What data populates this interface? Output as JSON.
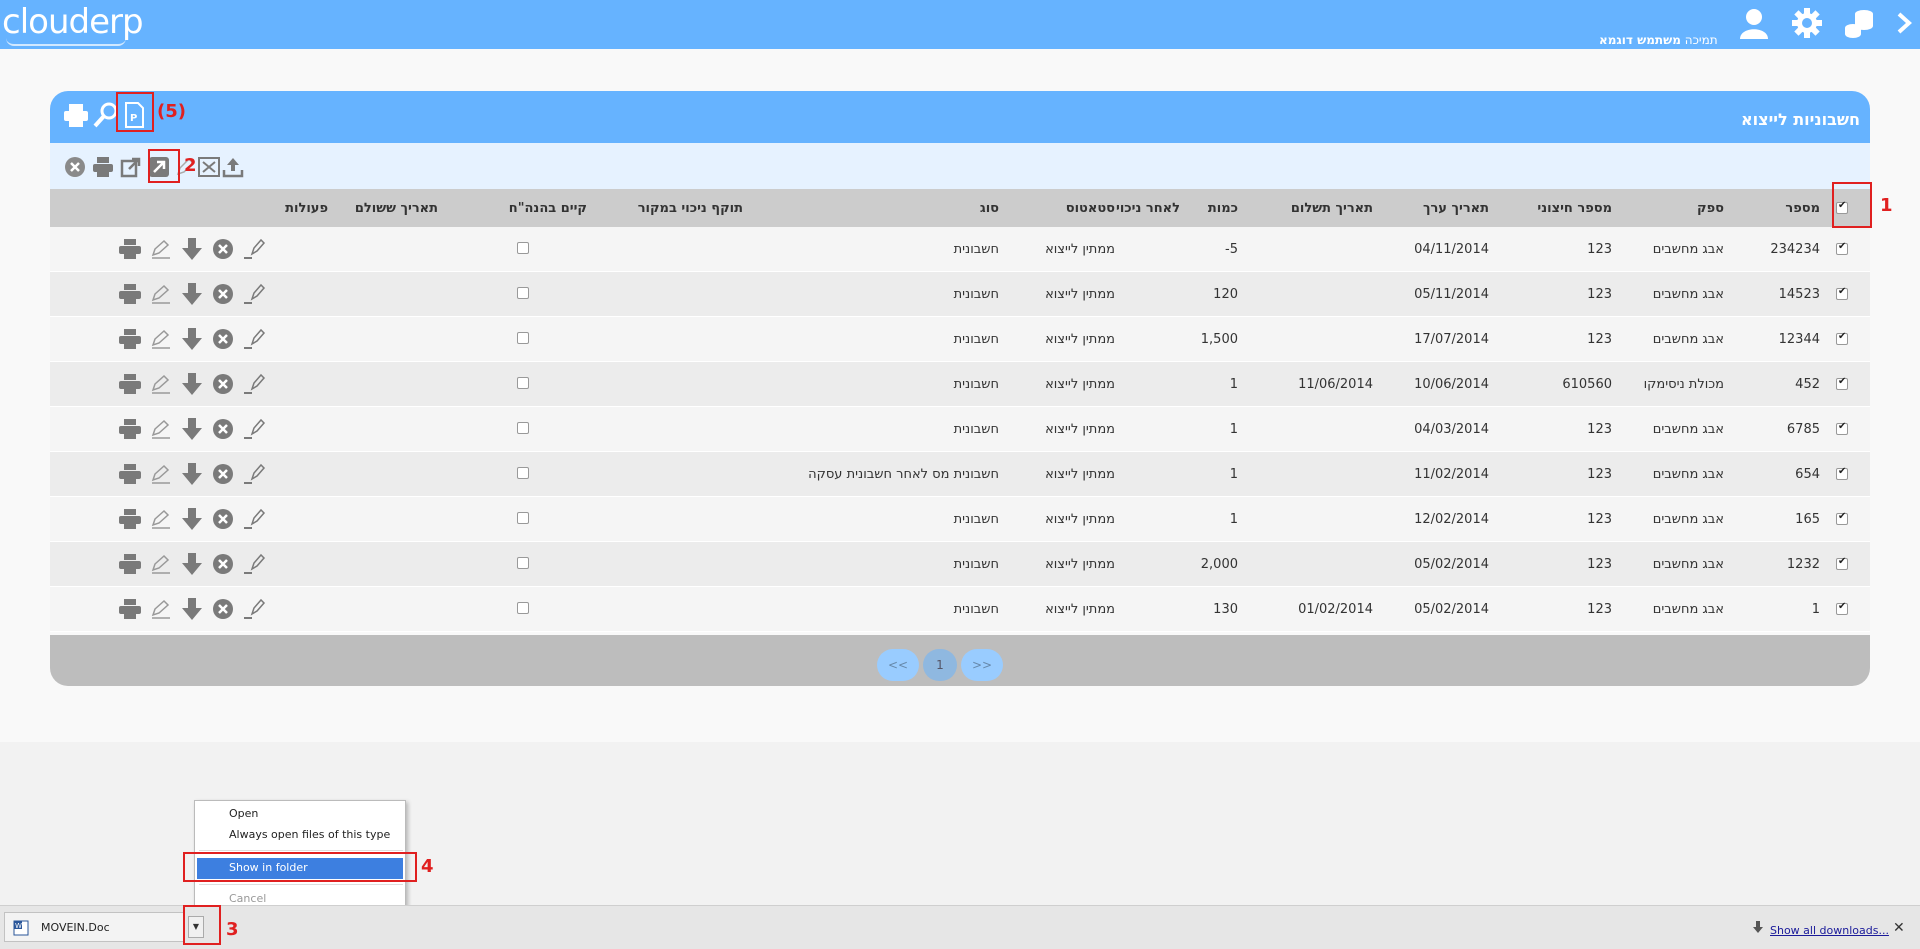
{
  "app": {
    "logo": "clouderp",
    "user": "משתמש דוגמא",
    "support": "תמיכה"
  },
  "header": {
    "title": "חשבוניות לייצוא"
  },
  "columns": [
    "מספר",
    "ספק",
    "מספר חיצוני",
    "תאריך ערך",
    "תאריך תשלום",
    "כמות",
    "לאחר ניכוי",
    "סטאטוס",
    "סוג",
    "תוקף ניכוי במקור",
    "קיים בהנה\"ח",
    "תאריך ששולם",
    "פעולות"
  ],
  "rows": [
    {
      "number": "234234",
      "supplier": "אבג מחשבים",
      "external": "123",
      "value_date": "04/11/2014",
      "pay_date": "",
      "amount": "5-",
      "status": "ממתין לייצוא",
      "type": "חשבונית",
      "checked": true
    },
    {
      "number": "14523",
      "supplier": "אבג מחשבים",
      "external": "123",
      "value_date": "05/11/2014",
      "pay_date": "",
      "amount": "120",
      "status": "ממתין לייצוא",
      "type": "חשבונית",
      "checked": true
    },
    {
      "number": "12344",
      "supplier": "אבג מחשבים",
      "external": "123",
      "value_date": "17/07/2014",
      "pay_date": "",
      "amount": "1,500",
      "status": "ממתין לייצוא",
      "type": "חשבונית",
      "checked": true
    },
    {
      "number": "452",
      "supplier": "מכולת ניסימקו",
      "external": "610560",
      "value_date": "10/06/2014",
      "pay_date": "11/06/2014",
      "amount": "1",
      "status": "ממתין לייצוא",
      "type": "חשבונית",
      "checked": true
    },
    {
      "number": "6785",
      "supplier": "אבג מחשבים",
      "external": "123",
      "value_date": "04/03/2014",
      "pay_date": "",
      "amount": "1",
      "status": "ממתין לייצוא",
      "type": "חשבונית",
      "checked": true
    },
    {
      "number": "654",
      "supplier": "אבג מחשבים",
      "external": "123",
      "value_date": "11/02/2014",
      "pay_date": "",
      "amount": "1",
      "status": "ממתין לייצוא",
      "type": "חשבונית מס לאחר חשבונית עסקה",
      "checked": true
    },
    {
      "number": "165",
      "supplier": "אבג מחשבים",
      "external": "123",
      "value_date": "12/02/2014",
      "pay_date": "",
      "amount": "1",
      "status": "ממתין לייצוא",
      "type": "חשבונית",
      "checked": true
    },
    {
      "number": "1232",
      "supplier": "אבג מחשבים",
      "external": "123",
      "value_date": "05/02/2014",
      "pay_date": "",
      "amount": "2,000",
      "status": "ממתין לייצוא",
      "type": "חשבונית",
      "checked": true
    },
    {
      "number": "1",
      "supplier": "אבג מחשבים",
      "external": "123",
      "value_date": "05/02/2014",
      "pay_date": "01/02/2014",
      "amount": "130",
      "status": "ממתין לייצוא",
      "type": "חשבונית",
      "checked": true
    }
  ],
  "pager": {
    "prev": "<<",
    "page": "1",
    "next": ">>"
  },
  "context_menu": {
    "open": "Open",
    "always_open": "Always open files of this type",
    "show_in_folder": "Show in folder",
    "cancel": "Cancel"
  },
  "download": {
    "file": "MOVEIN.Doc",
    "show_all": "Show all downloads...",
    "close": "✕"
  },
  "annotations": {
    "a1": "1",
    "a2": "2",
    "a3": "3",
    "a4": "4",
    "a5": "(5)"
  },
  "colors": {
    "accent": "#66b3ff",
    "annotation": "#e02020",
    "highlight": "#3d7fe0"
  }
}
